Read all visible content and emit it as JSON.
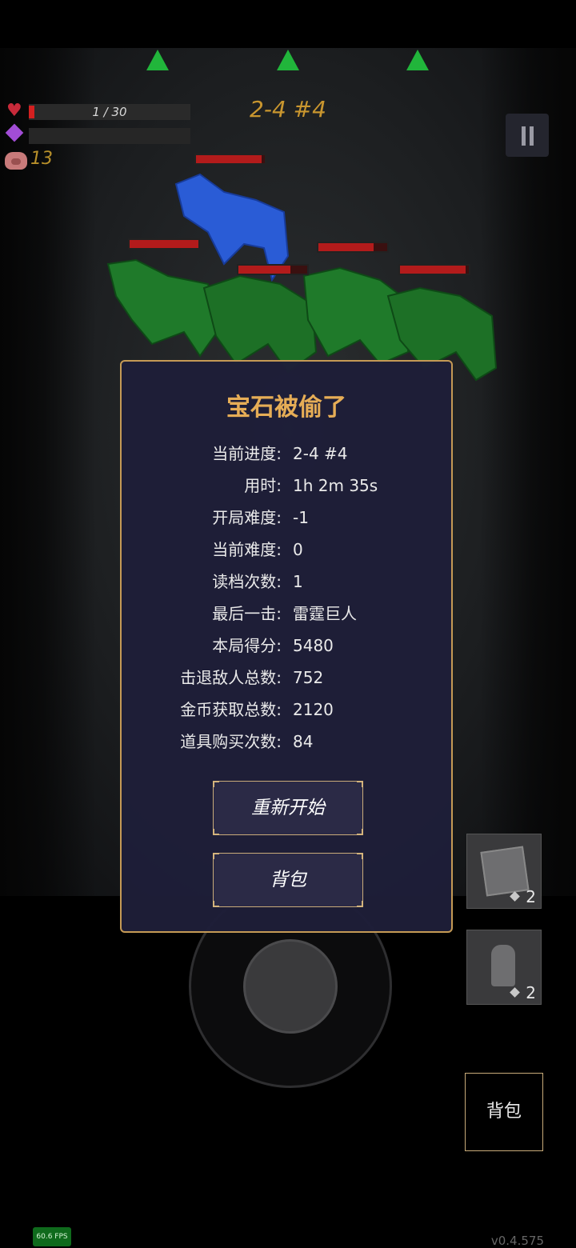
{
  "hud": {
    "hp_text": "1 / 30",
    "hp_fraction": 0.033,
    "coins": "13",
    "stage": "2-4 #4"
  },
  "dialog": {
    "title": "宝石被偷了",
    "stats": [
      {
        "label": "当前进度:",
        "value": "2-4 #4"
      },
      {
        "label": "用时:",
        "value": "1h 2m 35s"
      },
      {
        "label": "开局难度:",
        "value": "-1"
      },
      {
        "label": "当前难度:",
        "value": "0"
      },
      {
        "label": "读档次数:",
        "value": "1"
      },
      {
        "label": "最后一击:",
        "value": "雷霆巨人"
      },
      {
        "label": "本局得分:",
        "value": "5480"
      },
      {
        "label": "击退敌人总数:",
        "value": "752"
      },
      {
        "label": "金币获取总数:",
        "value": "2120"
      },
      {
        "label": "道具购买次数:",
        "value": "84"
      }
    ],
    "restart_label": "重新开始",
    "bag_label": "背包"
  },
  "items": [
    {
      "icon": "cube-icon",
      "count": "2"
    },
    {
      "icon": "statue-icon",
      "count": "2"
    }
  ],
  "bag_button_label": "背包",
  "fps": "60.6 FPS",
  "version": "v0.4.575",
  "colors": {
    "accent": "#e6ad56",
    "hp": "#d42020",
    "panel": "#1e1e38",
    "enemy_green": "#1f7a2a",
    "enemy_blue": "#2a5cd6"
  }
}
